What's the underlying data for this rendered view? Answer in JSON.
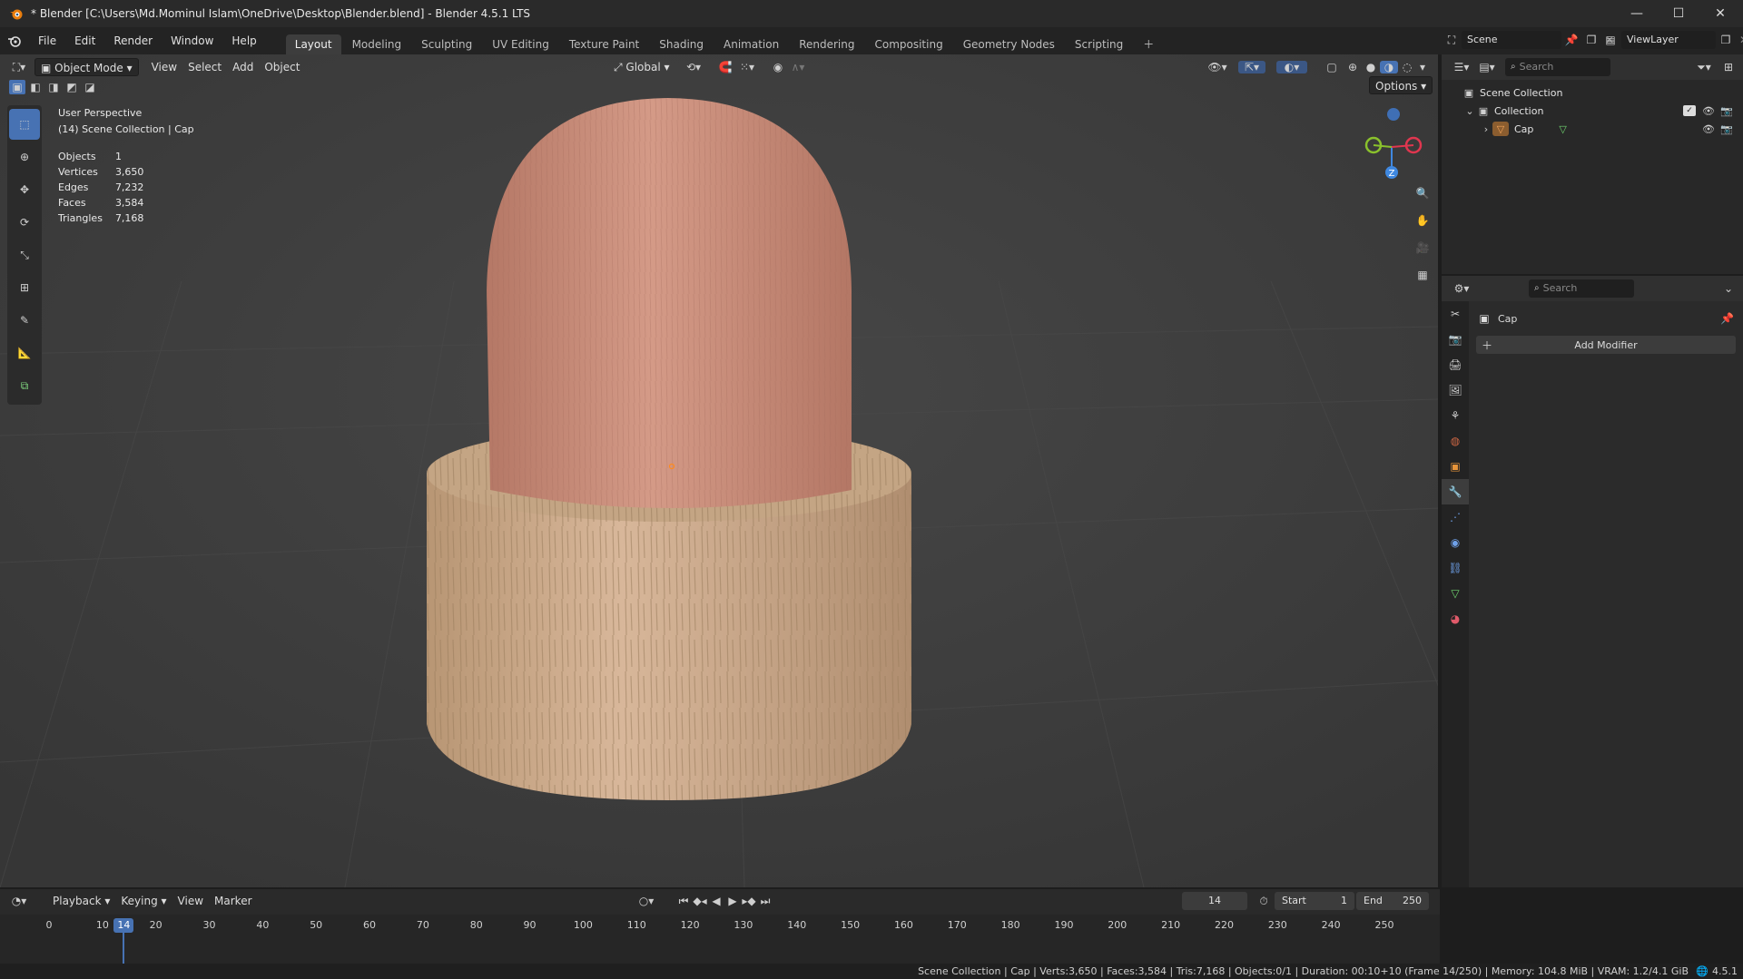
{
  "window": {
    "title": "* Blender [C:\\Users\\Md.Mominul Islam\\OneDrive\\Desktop\\Blender.blend] - Blender 4.5.1 LTS"
  },
  "menu": [
    "File",
    "Edit",
    "Render",
    "Window",
    "Help"
  ],
  "workspaces": [
    "Layout",
    "Modeling",
    "Sculpting",
    "UV Editing",
    "Texture Paint",
    "Shading",
    "Animation",
    "Rendering",
    "Compositing",
    "Geometry Nodes",
    "Scripting"
  ],
  "active_workspace": "Layout",
  "scene": {
    "name": "Scene",
    "view_layer": "ViewLayer"
  },
  "viewport": {
    "mode": "Object Mode",
    "menus": [
      "View",
      "Select",
      "Add",
      "Object"
    ],
    "transform_orientation": "Global",
    "options_label": "Options",
    "perspective": "User Perspective",
    "context": "(14) Scene Collection | Cap",
    "stats": [
      {
        "label": "Objects",
        "value": "1"
      },
      {
        "label": "Vertices",
        "value": "3,650"
      },
      {
        "label": "Edges",
        "value": "7,232"
      },
      {
        "label": "Faces",
        "value": "3,584"
      },
      {
        "label": "Triangles",
        "value": "7,168"
      }
    ],
    "gizmo_z_label": "Z"
  },
  "outliner": {
    "search_placeholder": "Search",
    "items": [
      {
        "label": "Scene Collection"
      },
      {
        "label": "Collection"
      },
      {
        "label": "Cap"
      }
    ]
  },
  "properties": {
    "search_placeholder": "Search",
    "object_name": "Cap",
    "add_modifier_label": "Add Modifier"
  },
  "timeline": {
    "menus": [
      "Playback",
      "Keying",
      "View",
      "Marker"
    ],
    "current_frame": "14",
    "start_label": "Start",
    "start_value": "1",
    "end_label": "End",
    "end_value": "250",
    "ticks": [
      "0",
      "10",
      "20",
      "30",
      "40",
      "50",
      "60",
      "70",
      "80",
      "90",
      "100",
      "110",
      "120",
      "130",
      "140",
      "150",
      "160",
      "170",
      "180",
      "190",
      "200",
      "210",
      "220",
      "230",
      "240",
      "250"
    ]
  },
  "statusbar": {
    "text": "Scene Collection | Cap | Verts:3,650 | Faces:3,584 | Tris:7,168 | Objects:0/1 | Duration: 00:10+10 (Frame 14/250) | Memory: 104.8 MiB | VRAM: 1.2/4.1 GiB",
    "version": "4.5.1"
  },
  "colors": {
    "accent": "#4772b3",
    "viewport_bg": "#3d3d3d",
    "cap_dome": "#c98c7a",
    "cap_base": "#c9a887"
  }
}
